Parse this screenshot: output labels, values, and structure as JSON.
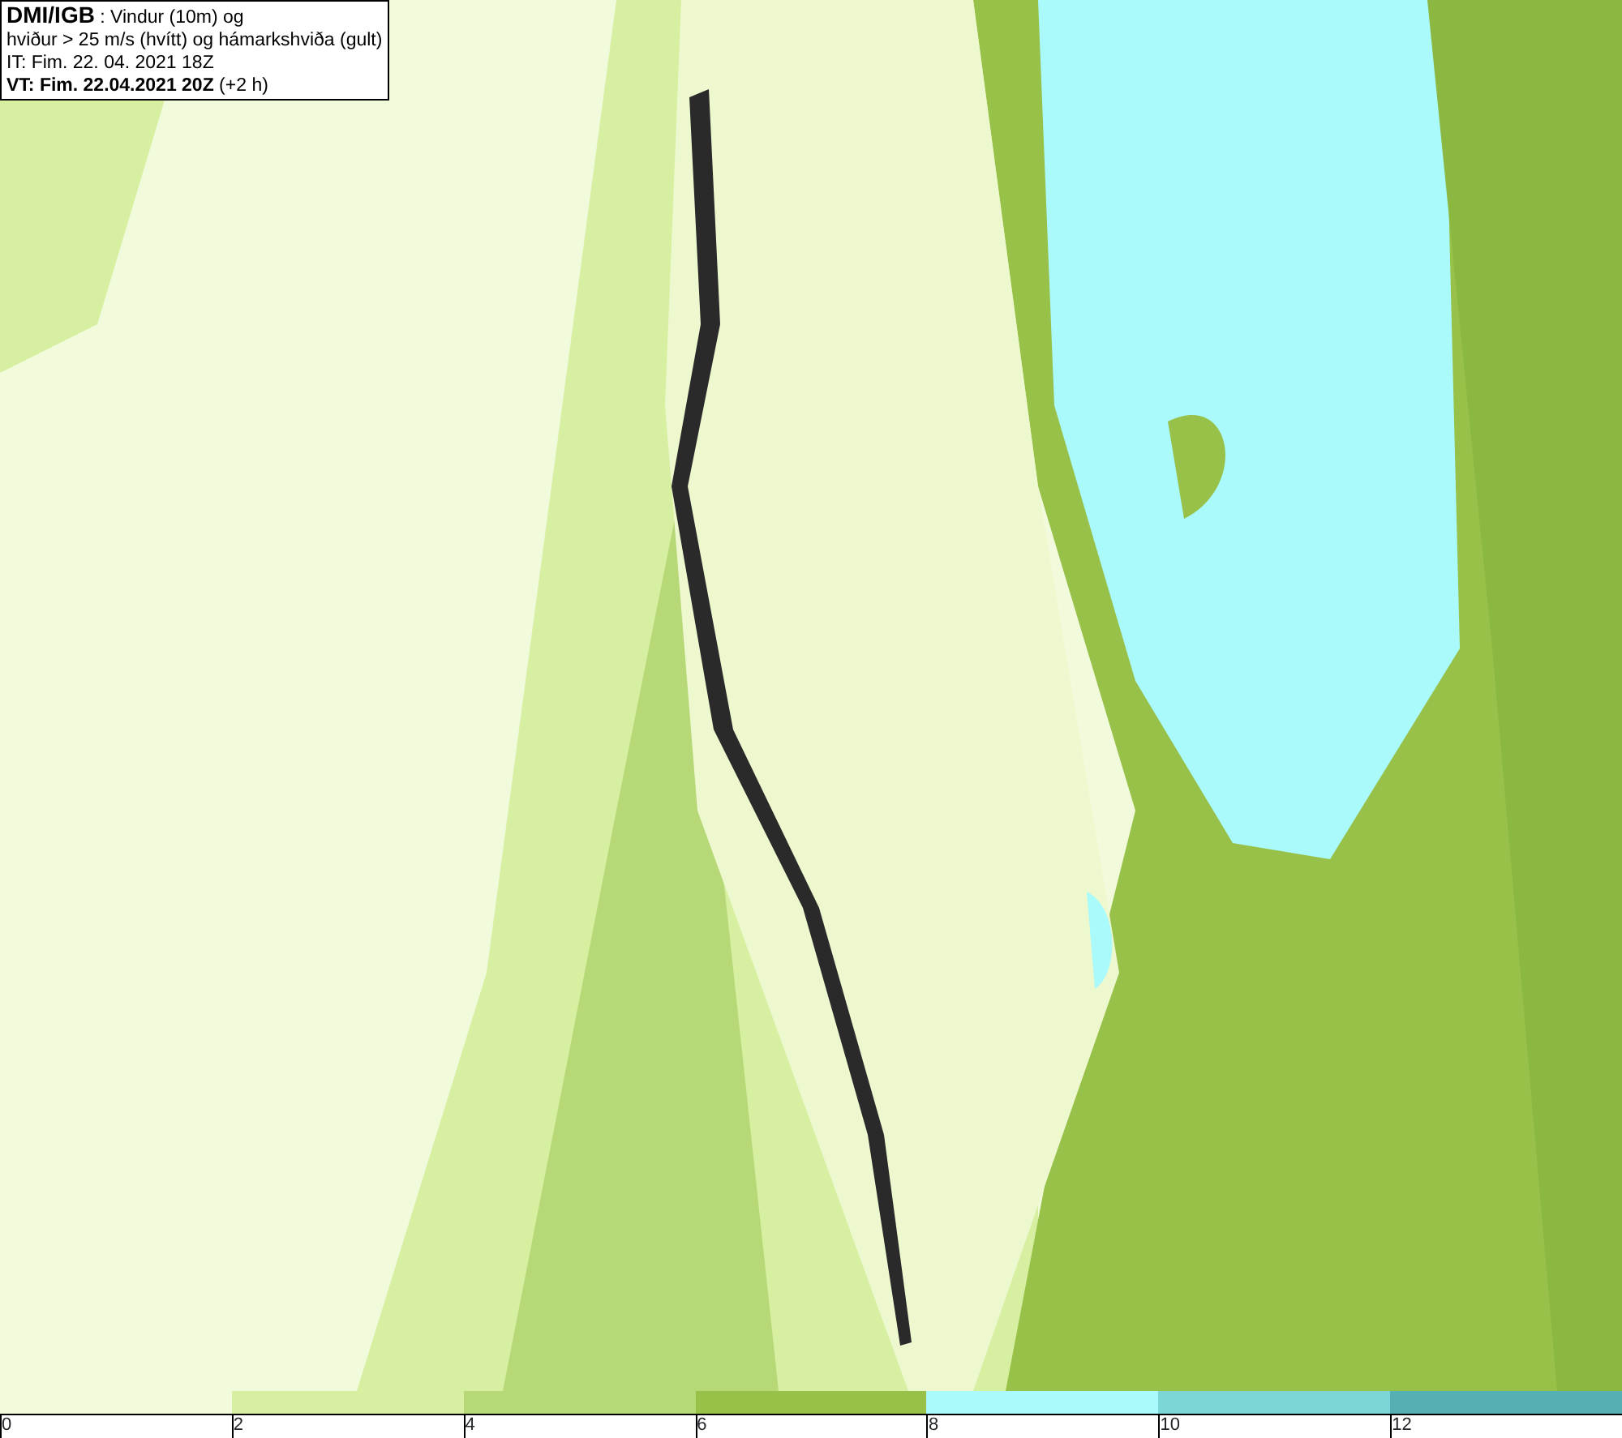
{
  "header": {
    "lines": [
      "**DMI/IGB** : Vindur (10m) og",
      "hviður > 25 m/s (hvítt) og hámarkshviða (gult)",
      "IT: Fim. 22. 04. 2021 18Z",
      "**VT: Fim. 22.04.2021 20Z** (+2 h)"
    ]
  },
  "legend": {
    "bins": [
      {
        "label": "0",
        "color": "#f2fadc"
      },
      {
        "label": "2",
        "color": "#d6efa0"
      },
      {
        "label": "4",
        "color": "#b6d877"
      },
      {
        "label": "6",
        "color": "#98c14a"
      },
      {
        "label": "8",
        "color": "#aaf9fb"
      },
      {
        "label": "10",
        "color": "#7dd6d6"
      },
      {
        "label": "12",
        "color": "#55b0b3"
      }
    ]
  }
}
